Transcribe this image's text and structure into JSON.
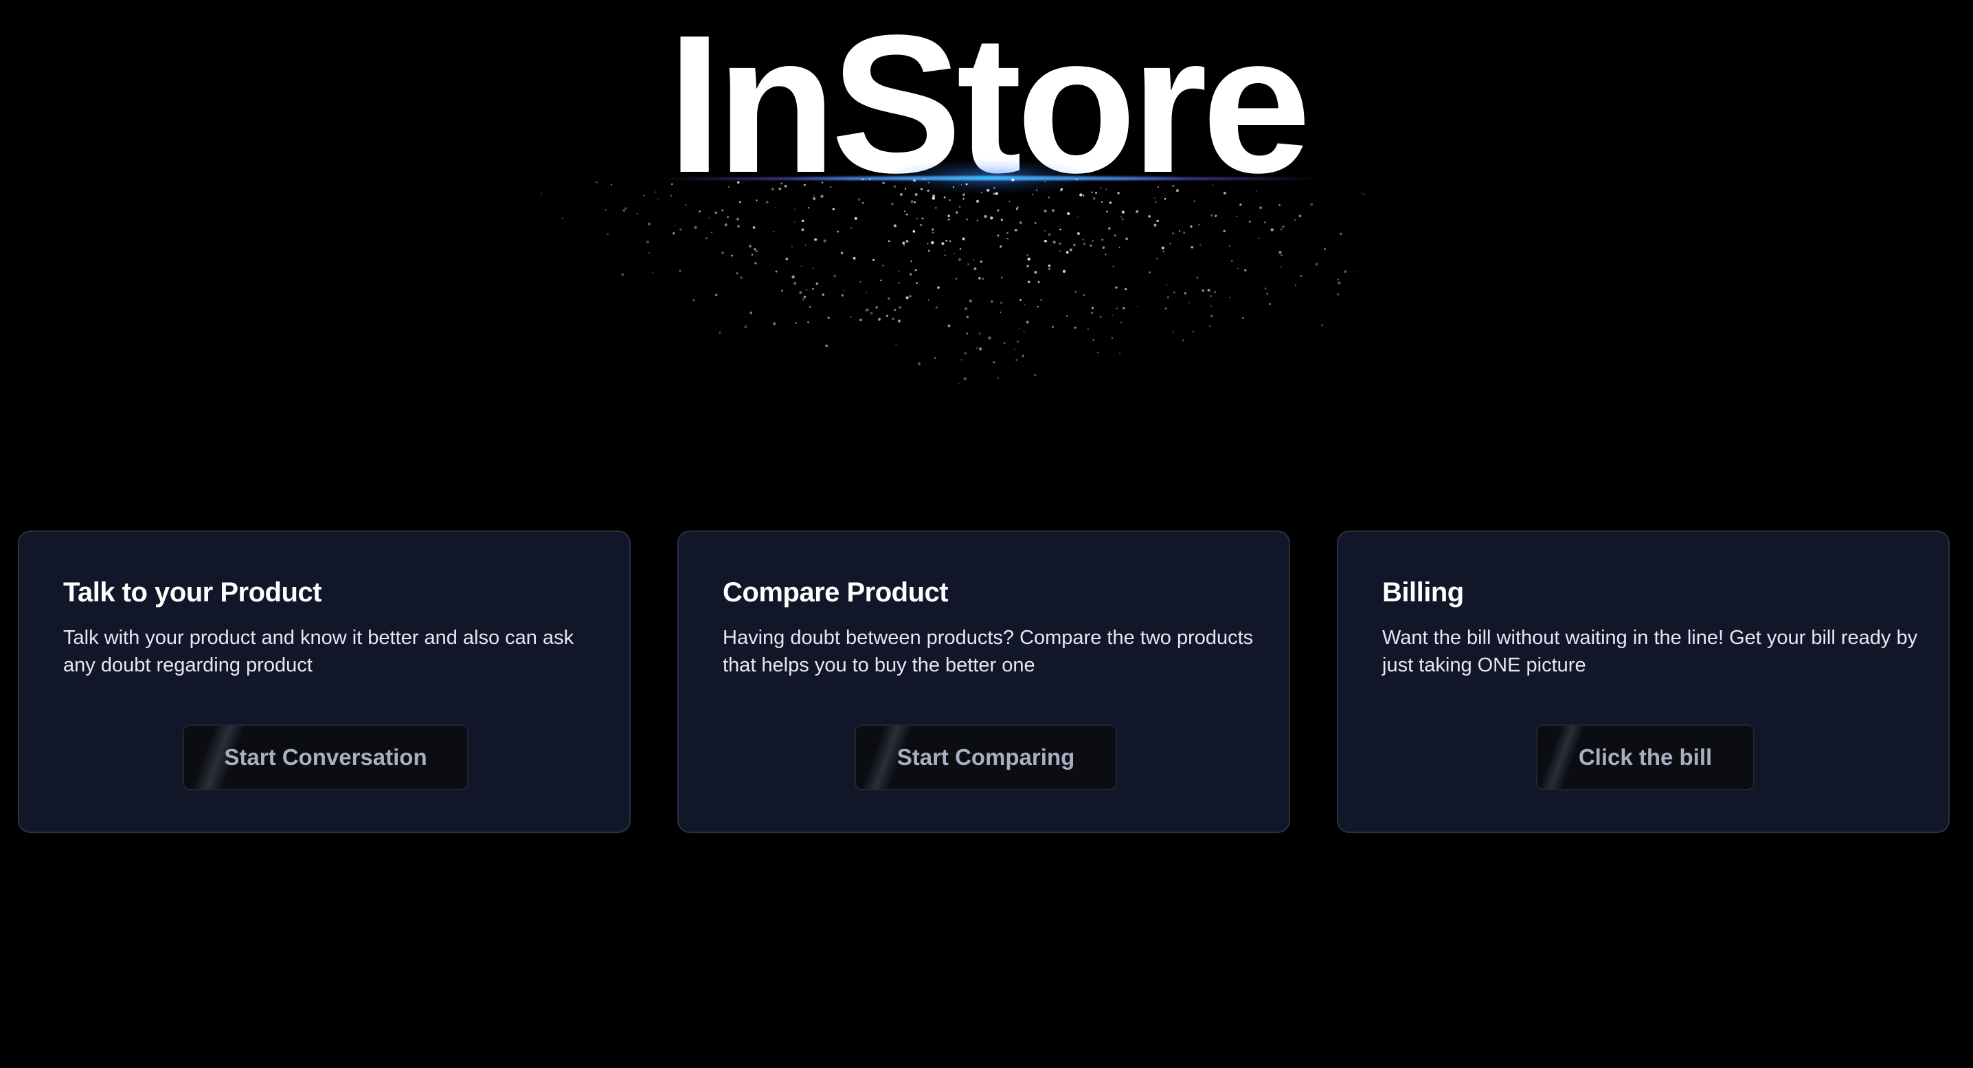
{
  "brand": {
    "title": "InStore"
  },
  "colors": {
    "background": "#000000",
    "card_background": "#121629",
    "card_border": "#2a3145",
    "button_background": "#0b0d12",
    "button_text": "#a8b0c2",
    "glow_accent": "#3b82f6"
  },
  "cards": [
    {
      "title": "Talk to your Product",
      "description": "Talk with your product and know it better and also can ask any doubt regarding product",
      "button_label": "Start Conversation"
    },
    {
      "title": "Compare Product",
      "description": "Having doubt between products? Compare the two products that helps you to buy the better one",
      "button_label": "Start Comparing"
    },
    {
      "title": "Billing",
      "description": "Want the bill without waiting in the line! Get your bill ready by just taking ONE picture",
      "button_label": "Click the bill"
    }
  ]
}
